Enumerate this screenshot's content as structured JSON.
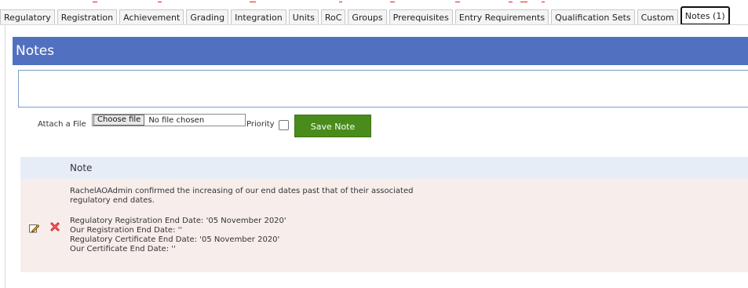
{
  "tabs": [
    {
      "label": "Regulatory"
    },
    {
      "label": "Registration"
    },
    {
      "label": "Achievement"
    },
    {
      "label": "Grading"
    },
    {
      "label": "Integration"
    },
    {
      "label": "Units"
    },
    {
      "label": "RoC"
    },
    {
      "label": "Groups"
    },
    {
      "label": "Prerequisites"
    },
    {
      "label": "Entry Requirements"
    },
    {
      "label": "Qualification Sets"
    },
    {
      "label": "Custom"
    },
    {
      "label": "Notes (1)"
    }
  ],
  "panel": {
    "title": "Notes"
  },
  "form": {
    "attach_label": "Attach a File",
    "choose_file_label": "Choose file",
    "no_file_text": "No file chosen",
    "priority_label": "Priority",
    "priority_checked": false,
    "save_label": "Save Note"
  },
  "table": {
    "header": "Note",
    "rows": [
      {
        "lines": [
          "RachelAOAdmin confirmed the increasing of our end dates past that of their associated",
          "regulatory end dates.",
          "",
          "Regulatory Registration End Date: '05 November 2020'",
          "Our Registration End Date: ''",
          "Regulatory Certificate End Date: '05 November 2020'",
          "Our Certificate End Date: ''"
        ]
      }
    ]
  },
  "colors": {
    "header_bg": "#5170c0",
    "save_button": "#4a8c1c",
    "row_bg": "#f7eeec",
    "table_header_bg": "#e7edf7",
    "delete_icon": "#d62020"
  },
  "icons": {
    "edit": "pencil-edit-icon",
    "delete": "red-x-delete-icon"
  }
}
